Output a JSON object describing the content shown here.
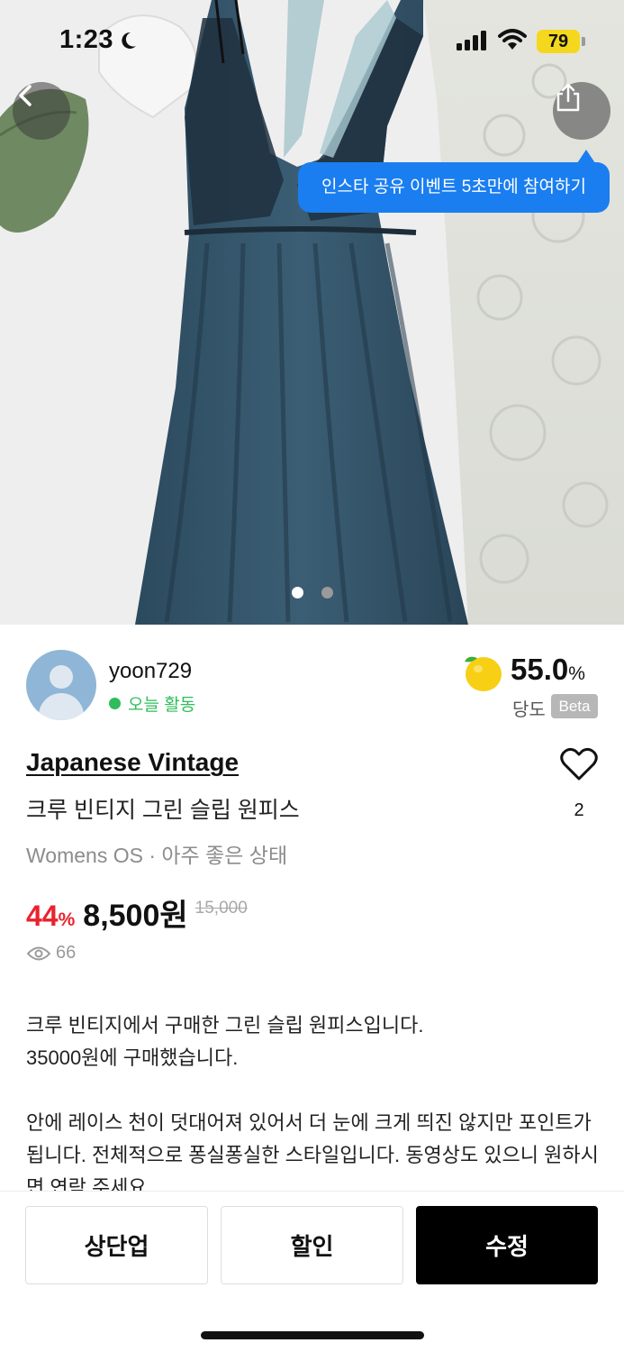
{
  "status_bar": {
    "time": "1:23",
    "battery": "79"
  },
  "photo": {
    "description_icon": "dress-photo",
    "page_index": 1,
    "page_count": 2
  },
  "share_tooltip": "인스타 공유 이벤트 5초만에 참여하기",
  "seller": {
    "username": "yoon729",
    "activity": "오늘 활동",
    "score": "55.0",
    "score_unit": "%",
    "score_label": "당도",
    "score_badge": "Beta",
    "colors": {
      "active": "#2ebd5a",
      "avatar": "#8fb6d6"
    }
  },
  "product": {
    "brand": "Japanese Vintage",
    "title": "크루 빈티지 그린 슬립 원피스",
    "meta": "Womens OS · 아주 좋은 상태",
    "likes": "2",
    "discount": "44",
    "discount_sign": "%",
    "price": "8,500원",
    "original_price": "15,000",
    "views": "66",
    "description": [
      "크루 빈티지에서 구매한 그린 슬립 원피스입니다.",
      "35000원에 구매했습니다.",
      "",
      "안에 레이스 천이 덧대어져 있어서 더 눈에 크게 띄진 않지만 포인트가 됩니다. 전체적으로 퐁실퐁실한 스타일입니다. 동영상도 있으니 원하시면 연락 주세요."
    ],
    "colors": {
      "discount": "#e8232d"
    }
  },
  "actions": {
    "bump": "상단업",
    "discount": "할인",
    "edit": "수정"
  },
  "icons": [
    "back-arrow-icon",
    "share-icon",
    "heart-icon",
    "eye-icon",
    "moon-icon",
    "signal-icon",
    "wifi-icon",
    "sweetness-fruit-icon"
  ],
  "accent": "#1a7ef0"
}
